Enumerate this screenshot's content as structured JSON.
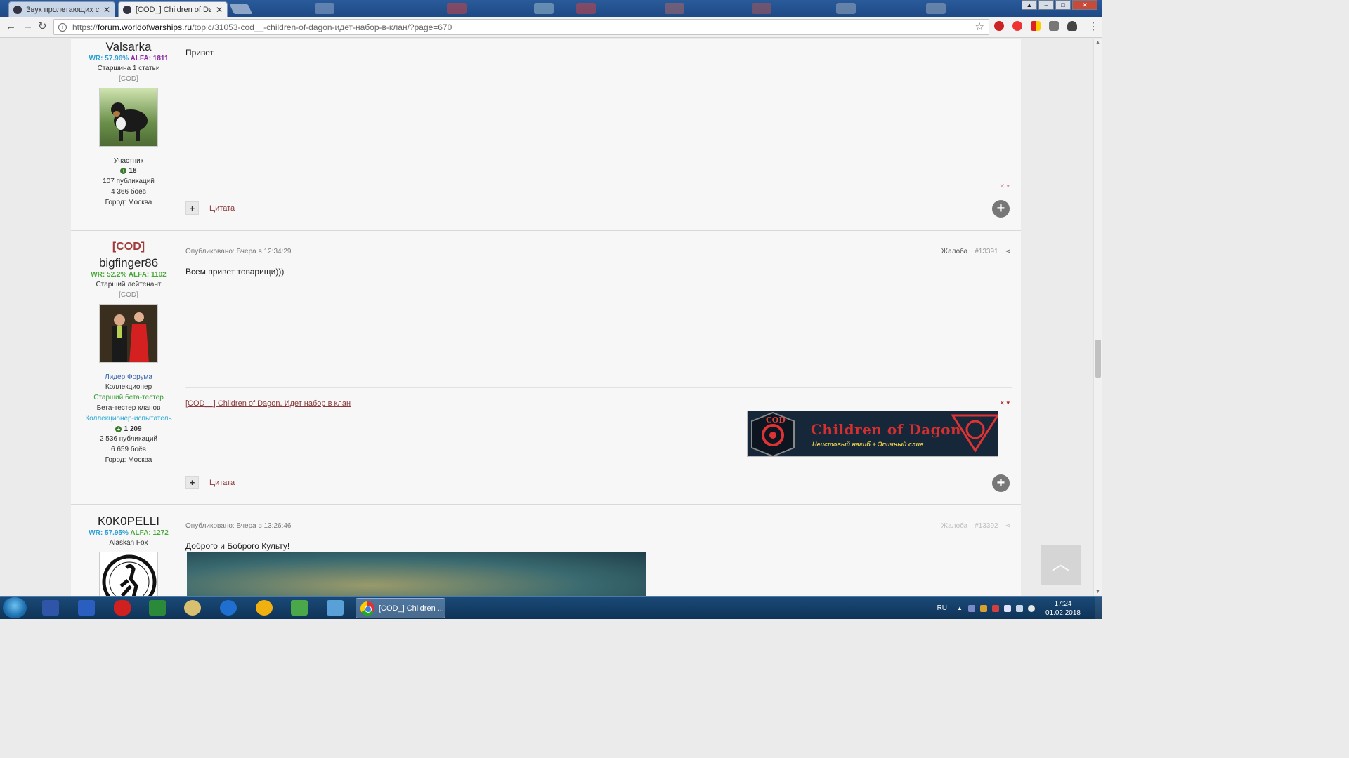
{
  "browser": {
    "tabs": [
      {
        "title": "Звук пролетающих самолётов",
        "active": false
      },
      {
        "title": "[COD_] Children of Dagon",
        "active": true
      }
    ],
    "url_prefix": "https://",
    "url_domain": "forum.worldofwarships.ru",
    "url_path": "/topic/31053-cod__-children-of-dagon-идет-набор-в-клан/?page=670"
  },
  "posts": [
    {
      "nickname": "Valsarka",
      "wr_label": "WR: 57.96%",
      "alfa_label": "ALFA: 1811",
      "wr_color": "#2a9fd6",
      "alfa_color": "#8a2aa8",
      "rank": "Старшина 1 статьи",
      "clan_tag": "[COD]",
      "group": "Участник",
      "reputation": "18",
      "publications": "107 публикаций",
      "battles": "4 366 боёв",
      "city": "Город: Москва",
      "content": "Привет",
      "quote_label": "Цитата"
    },
    {
      "clan_heading": "[COD]",
      "nickname": "bigfinger86",
      "wr_label": "WR: 52.2%",
      "alfa_label": "ALFA: 1102",
      "wr_color": "#4aa83a",
      "alfa_color": "#4aa83a",
      "rank": "Старший лейтенант",
      "clan_tag": "[COD]",
      "badges": [
        {
          "text": "Лидер Форума",
          "color": "#2e5fa8"
        },
        {
          "text": "Коллекционер",
          "color": "#333333"
        },
        {
          "text": "Старший бета-тестер",
          "color": "#3a9a3a"
        },
        {
          "text": "Бета-тестер кланов",
          "color": "#333333"
        },
        {
          "text": "Коллекционер-испытатель",
          "color": "#2aa8d6"
        }
      ],
      "reputation": "1 209",
      "publications": "2 536 публикаций",
      "battles": "6 659 боёв",
      "city": "Город: Москва",
      "published": "Опубликовано: Вчера в 12:34:29",
      "report": "Жалоба",
      "post_number": "#13391",
      "content": "Всем привет товарищи)))",
      "signature_link": "[COD__] Children of Dagon. Идет набор в клан",
      "banner": {
        "clan": "COD",
        "name": "Children of Dagon",
        "tagline": "Неистовый нагиб + Эпичный слив"
      },
      "quote_label": "Цитата"
    },
    {
      "nickname": "K0K0PELLI",
      "wr_label": "WR: 57.95%",
      "alfa_label": "ALFA: 1272",
      "wr_color": "#2a9fd6",
      "alfa_color": "#4aa83a",
      "rank": "Alaskan Fox",
      "published": "Опубликовано: Вчера в 13:26:46",
      "report": "Жалоба",
      "post_number": "#13392",
      "content": "Доброго и Боброго Культу!"
    }
  ],
  "taskbar": {
    "active_window": "[COD_] Children ...",
    "language": "RU",
    "time": "17:24",
    "date": "01.02.2018"
  }
}
